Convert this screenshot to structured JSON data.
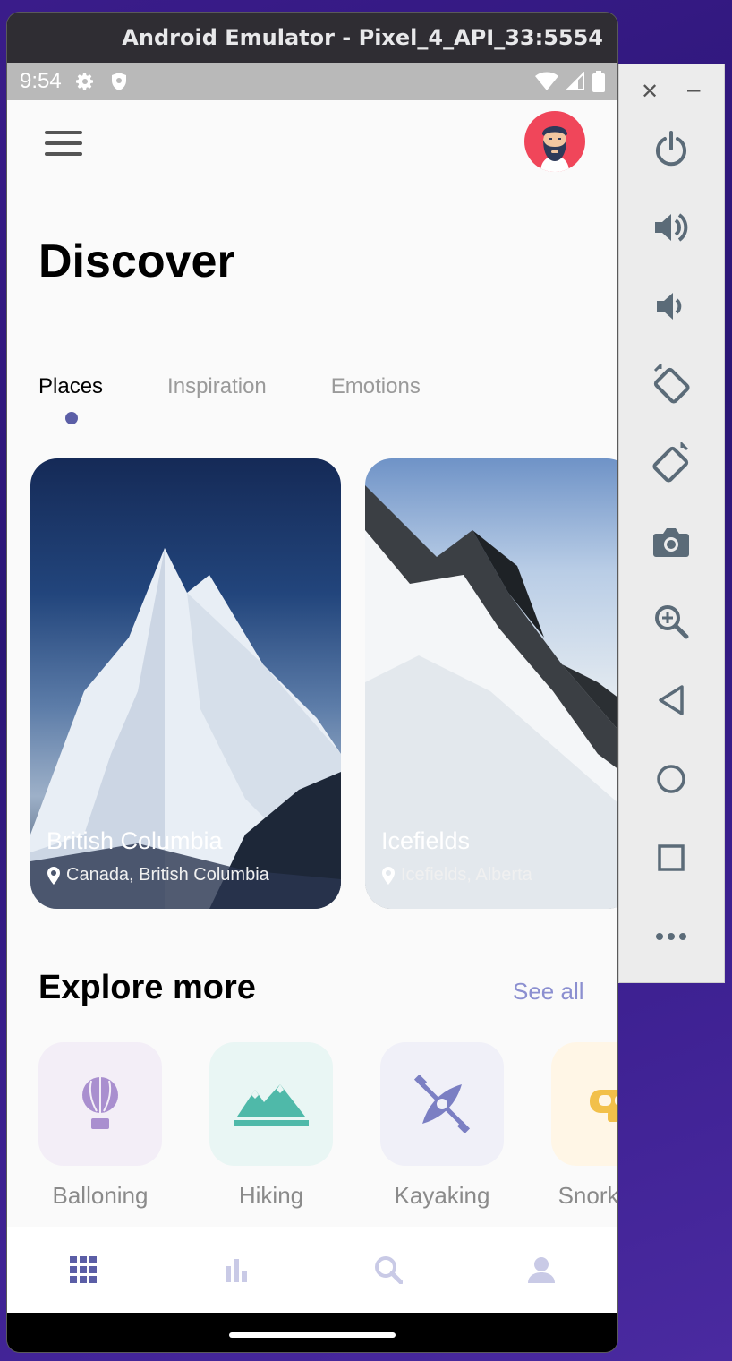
{
  "window": {
    "title": "Android Emulator - Pixel_4_API_33:5554"
  },
  "status_bar": {
    "time": "9:54"
  },
  "app": {
    "title": "Discover",
    "tabs": [
      {
        "label": "Places",
        "active": true
      },
      {
        "label": "Inspiration",
        "active": false
      },
      {
        "label": "Emotions",
        "active": false
      }
    ],
    "places": [
      {
        "title": "British Columbia",
        "location": "Canada, British Columbia"
      },
      {
        "title": "Icefields",
        "location": "Icefields, Alberta"
      }
    ],
    "explore": {
      "title": "Explore more",
      "see_all": "See all",
      "categories": [
        {
          "label": "Balloning",
          "icon": "balloon-icon",
          "tile_color": "#f3eef7",
          "icon_color": "#a98fcf"
        },
        {
          "label": "Hiking",
          "icon": "mountains-icon",
          "tile_color": "#e9f6f4",
          "icon_color": "#4fb9a9"
        },
        {
          "label": "Kayaking",
          "icon": "kayak-icon",
          "tile_color": "#f0f0f8",
          "icon_color": "#7b7fc3"
        },
        {
          "label": "Snorkeling",
          "icon": "snorkel-icon",
          "tile_color": "#fff6e6",
          "icon_color": "#f2c04a"
        }
      ]
    },
    "bottom_nav": [
      {
        "icon": "grid-icon",
        "active": true
      },
      {
        "icon": "bar-chart-icon",
        "active": false
      },
      {
        "icon": "search-icon",
        "active": false
      },
      {
        "icon": "person-icon",
        "active": false
      }
    ]
  },
  "emulator_controls": [
    "power-icon",
    "volume-up-icon",
    "volume-down-icon",
    "rotate-left-icon",
    "rotate-right-icon",
    "camera-icon",
    "zoom-icon",
    "back-icon",
    "home-icon",
    "overview-icon",
    "more-icon"
  ],
  "colors": {
    "accent": "#5b5ea6",
    "see_all": "#8b8fd0",
    "avatar_bg": "#f0465a"
  }
}
